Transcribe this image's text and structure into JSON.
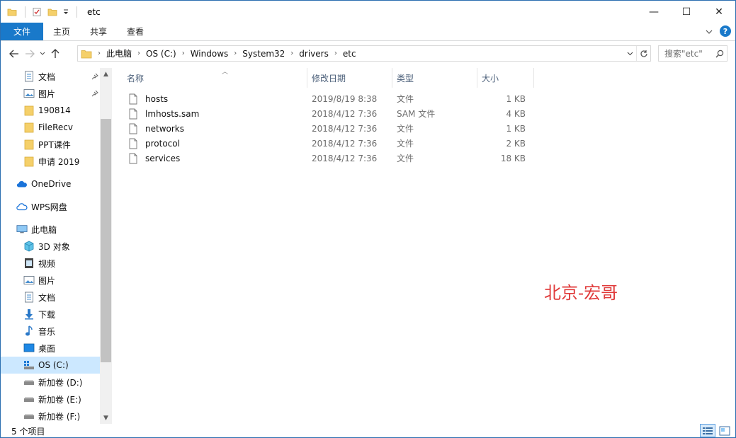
{
  "window": {
    "title": "etc",
    "controls": {
      "minimize": "—",
      "maximize": "☐",
      "close": "✕"
    }
  },
  "ribbon": {
    "tabs": [
      "文件",
      "主页",
      "共享",
      "查看"
    ],
    "help": "?"
  },
  "addressbar": {
    "crumbs": [
      "此电脑",
      "OS (C:)",
      "Windows",
      "System32",
      "drivers",
      "etc"
    ]
  },
  "search": {
    "placeholder": "搜索\"etc\""
  },
  "navpane": {
    "quick_access": [
      {
        "label": "文档",
        "icon": "document-icon",
        "pinned": true
      },
      {
        "label": "图片",
        "icon": "pictures-icon",
        "pinned": true
      },
      {
        "label": "190814",
        "icon": "folder-icon",
        "pinned": false
      },
      {
        "label": "FileRecv",
        "icon": "folder-icon",
        "pinned": false
      },
      {
        "label": "PPT课件",
        "icon": "folder-icon",
        "pinned": false
      },
      {
        "label": "申请 2019",
        "icon": "folder-icon",
        "pinned": false
      }
    ],
    "onedrive": "OneDrive",
    "wps": "WPS网盘",
    "this_pc": "此电脑",
    "pc_items": [
      {
        "label": "3D 对象",
        "icon": "3d-objects-icon"
      },
      {
        "label": "视频",
        "icon": "video-icon"
      },
      {
        "label": "图片",
        "icon": "pictures-icon"
      },
      {
        "label": "文档",
        "icon": "document-icon"
      },
      {
        "label": "下载",
        "icon": "download-icon"
      },
      {
        "label": "音乐",
        "icon": "music-icon"
      },
      {
        "label": "桌面",
        "icon": "desktop-icon"
      },
      {
        "label": "OS (C:)",
        "icon": "os-drive-icon",
        "selected": true
      },
      {
        "label": "新加卷 (D:)",
        "icon": "drive-icon"
      },
      {
        "label": "新加卷 (E:)",
        "icon": "drive-icon"
      },
      {
        "label": "新加卷 (F:)",
        "icon": "drive-icon"
      }
    ]
  },
  "filelist": {
    "columns": [
      "名称",
      "修改日期",
      "类型",
      "大小"
    ],
    "rows": [
      {
        "name": "hosts",
        "date": "2019/8/19 8:38",
        "type": "文件",
        "size": "1 KB"
      },
      {
        "name": "lmhosts.sam",
        "date": "2018/4/12 7:36",
        "type": "SAM 文件",
        "size": "4 KB"
      },
      {
        "name": "networks",
        "date": "2018/4/12 7:36",
        "type": "文件",
        "size": "1 KB"
      },
      {
        "name": "protocol",
        "date": "2018/4/12 7:36",
        "type": "文件",
        "size": "2 KB"
      },
      {
        "name": "services",
        "date": "2018/4/12 7:36",
        "type": "文件",
        "size": "18 KB"
      }
    ]
  },
  "watermark": "北京-宏哥",
  "status": {
    "count": "5 个项目"
  },
  "colors": {
    "accent": "#1979ca",
    "selection": "#cce8ff",
    "watermark": "#e03a3a"
  }
}
